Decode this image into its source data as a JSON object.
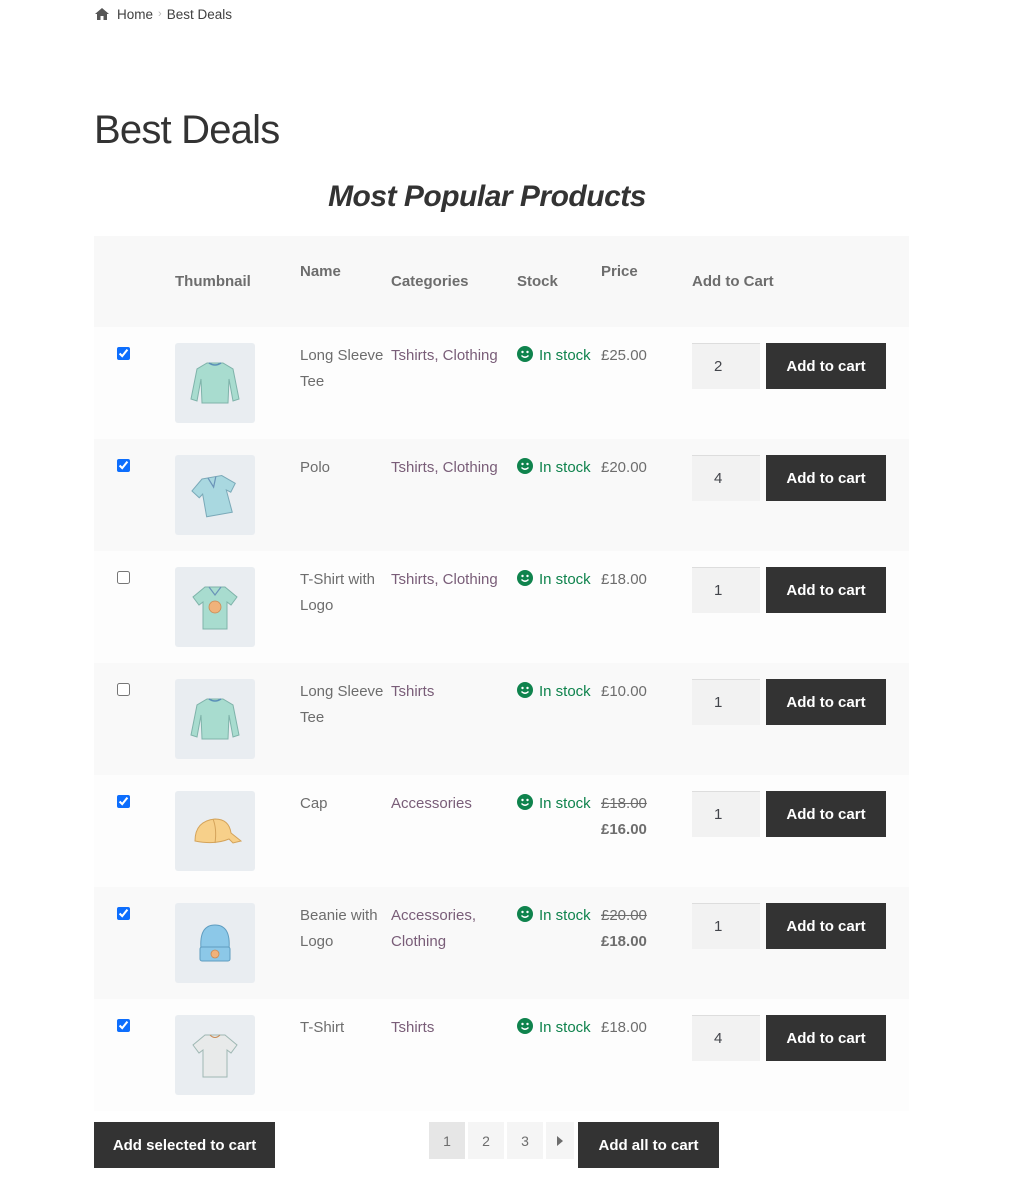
{
  "breadcrumb": {
    "icon": "home-icon",
    "items": [
      "Home",
      "Best Deals"
    ],
    "separator": "›"
  },
  "page_title": "Best Deals",
  "table_title": "Most Popular Products",
  "table": {
    "headers": [
      "",
      "Thumbnail",
      "Name",
      "Categories",
      "Stock",
      "Price",
      "Add to Cart"
    ],
    "rows": [
      {
        "checked": true,
        "thumbnail": "long-sleeve-tee-image",
        "name": "Long Sleeve Tee",
        "categories": "Tshirts, Clothing",
        "stock": "In stock",
        "price": "£25.00",
        "sale_from": null,
        "quantity": "2",
        "button": "Add to cart"
      },
      {
        "checked": true,
        "thumbnail": "polo-image",
        "name": "Polo",
        "categories": "Tshirts, Clothing",
        "stock": "In stock",
        "price": "£20.00",
        "sale_from": null,
        "quantity": "4",
        "button": "Add to cart"
      },
      {
        "checked": false,
        "thumbnail": "tshirt-with-logo-image",
        "name": "T-Shirt with Logo",
        "categories": "Tshirts, Clothing",
        "stock": "In stock",
        "price": "£18.00",
        "sale_from": null,
        "quantity": "1",
        "button": "Add to cart"
      },
      {
        "checked": false,
        "thumbnail": "long-sleeve-tee-image",
        "name": "Long Sleeve Tee",
        "categories": "Tshirts",
        "stock": "In stock",
        "price": "£10.00",
        "sale_from": null,
        "quantity": "1",
        "button": "Add to cart"
      },
      {
        "checked": true,
        "thumbnail": "cap-image",
        "name": "Cap",
        "categories": "Accessories",
        "stock": "In stock",
        "price": "£16.00",
        "sale_from": "£18.00",
        "quantity": "1",
        "button": "Add to cart"
      },
      {
        "checked": true,
        "thumbnail": "beanie-with-logo-image",
        "name": "Beanie with Logo",
        "categories": "Accessories, Clothing",
        "stock": "In stock",
        "price": "£18.00",
        "sale_from": "£20.00",
        "quantity": "1",
        "button": "Add to cart"
      },
      {
        "checked": true,
        "thumbnail": "tshirt-image",
        "name": "T-Shirt",
        "categories": "Tshirts",
        "stock": "In stock",
        "price": "£18.00",
        "sale_from": null,
        "quantity": "4",
        "button": "Add to cart"
      }
    ]
  },
  "footer": {
    "add_selected_label": "Add selected to cart",
    "add_all_label": "Add all to cart",
    "pagination": {
      "pages": [
        "1",
        "2",
        "3"
      ],
      "current": "1",
      "next_icon": "caret-right-icon"
    }
  },
  "colors": {
    "button_bg": "#333333",
    "stock_green": "#0f834d",
    "category_link": "#795d78",
    "checkbox_accent": "#0d6efd"
  }
}
